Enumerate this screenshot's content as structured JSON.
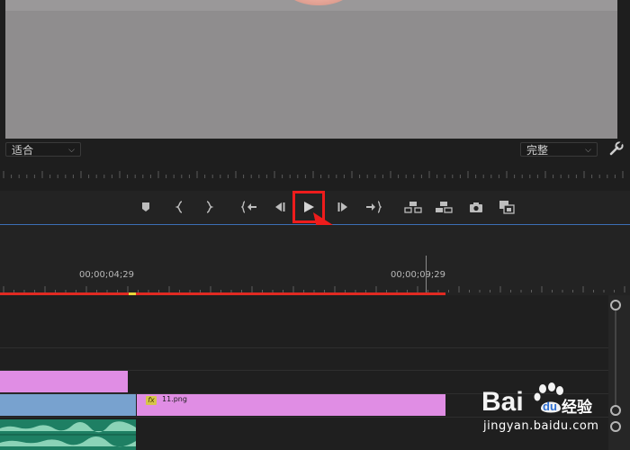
{
  "monitor": {
    "fit_label": "适合",
    "quality_label": "完整"
  },
  "timeline": {
    "timecodes": [
      "00;00;04;29",
      "00;00;09;29"
    ],
    "clip_name": "11.png",
    "fx_badge": "fx"
  },
  "watermark": {
    "brand": "Bai du",
    "brand_cn": "经验",
    "url": "jingyan.baidu.com"
  },
  "colors": {
    "accent_blue": "#3b6fb5",
    "render_bar": "#e02a22",
    "highlight": "#ee1c1c",
    "clip_pink": "#e08de4",
    "clip_blue": "#78a2cf",
    "audio_green": "#1e7f63"
  },
  "icons": [
    "add-marker-icon",
    "mark-in-icon",
    "mark-out-icon",
    "go-to-in-icon",
    "step-back-icon",
    "play-icon",
    "step-forward-icon",
    "go-to-out-icon",
    "lift-icon",
    "extract-icon",
    "export-frame-icon",
    "compare-view-icon",
    "wrench-icon"
  ]
}
